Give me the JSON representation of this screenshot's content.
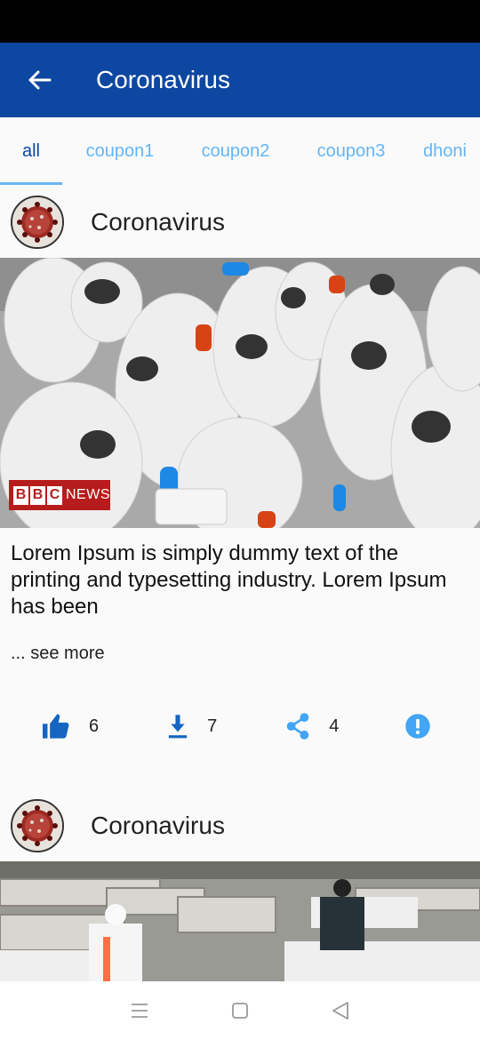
{
  "app_bar": {
    "title": "Coronavirus",
    "back_icon": "arrow-left-icon"
  },
  "tabs": [
    {
      "label": "all",
      "active": true
    },
    {
      "label": "coupon1",
      "active": false
    },
    {
      "label": "coupon2",
      "active": false
    },
    {
      "label": "coupon3",
      "active": false
    },
    {
      "label": "dhoni",
      "active": false
    }
  ],
  "posts": [
    {
      "author": "Coronavirus",
      "image_badge": {
        "letters": [
          "B",
          "B",
          "C"
        ],
        "word": "NEWS"
      },
      "text": "Lorem Ipsum is simply dummy text of the printing and typesetting industry. Lorem Ipsum has been",
      "see_more": "... see more",
      "likes": "6",
      "downloads": "7",
      "shares": "4"
    },
    {
      "author": "Coronavirus"
    }
  ],
  "colors": {
    "primary": "#0d47a1",
    "tab_inactive": "#64b5f6",
    "action_blue": "#1565c0",
    "share_blue": "#42a5f5"
  }
}
